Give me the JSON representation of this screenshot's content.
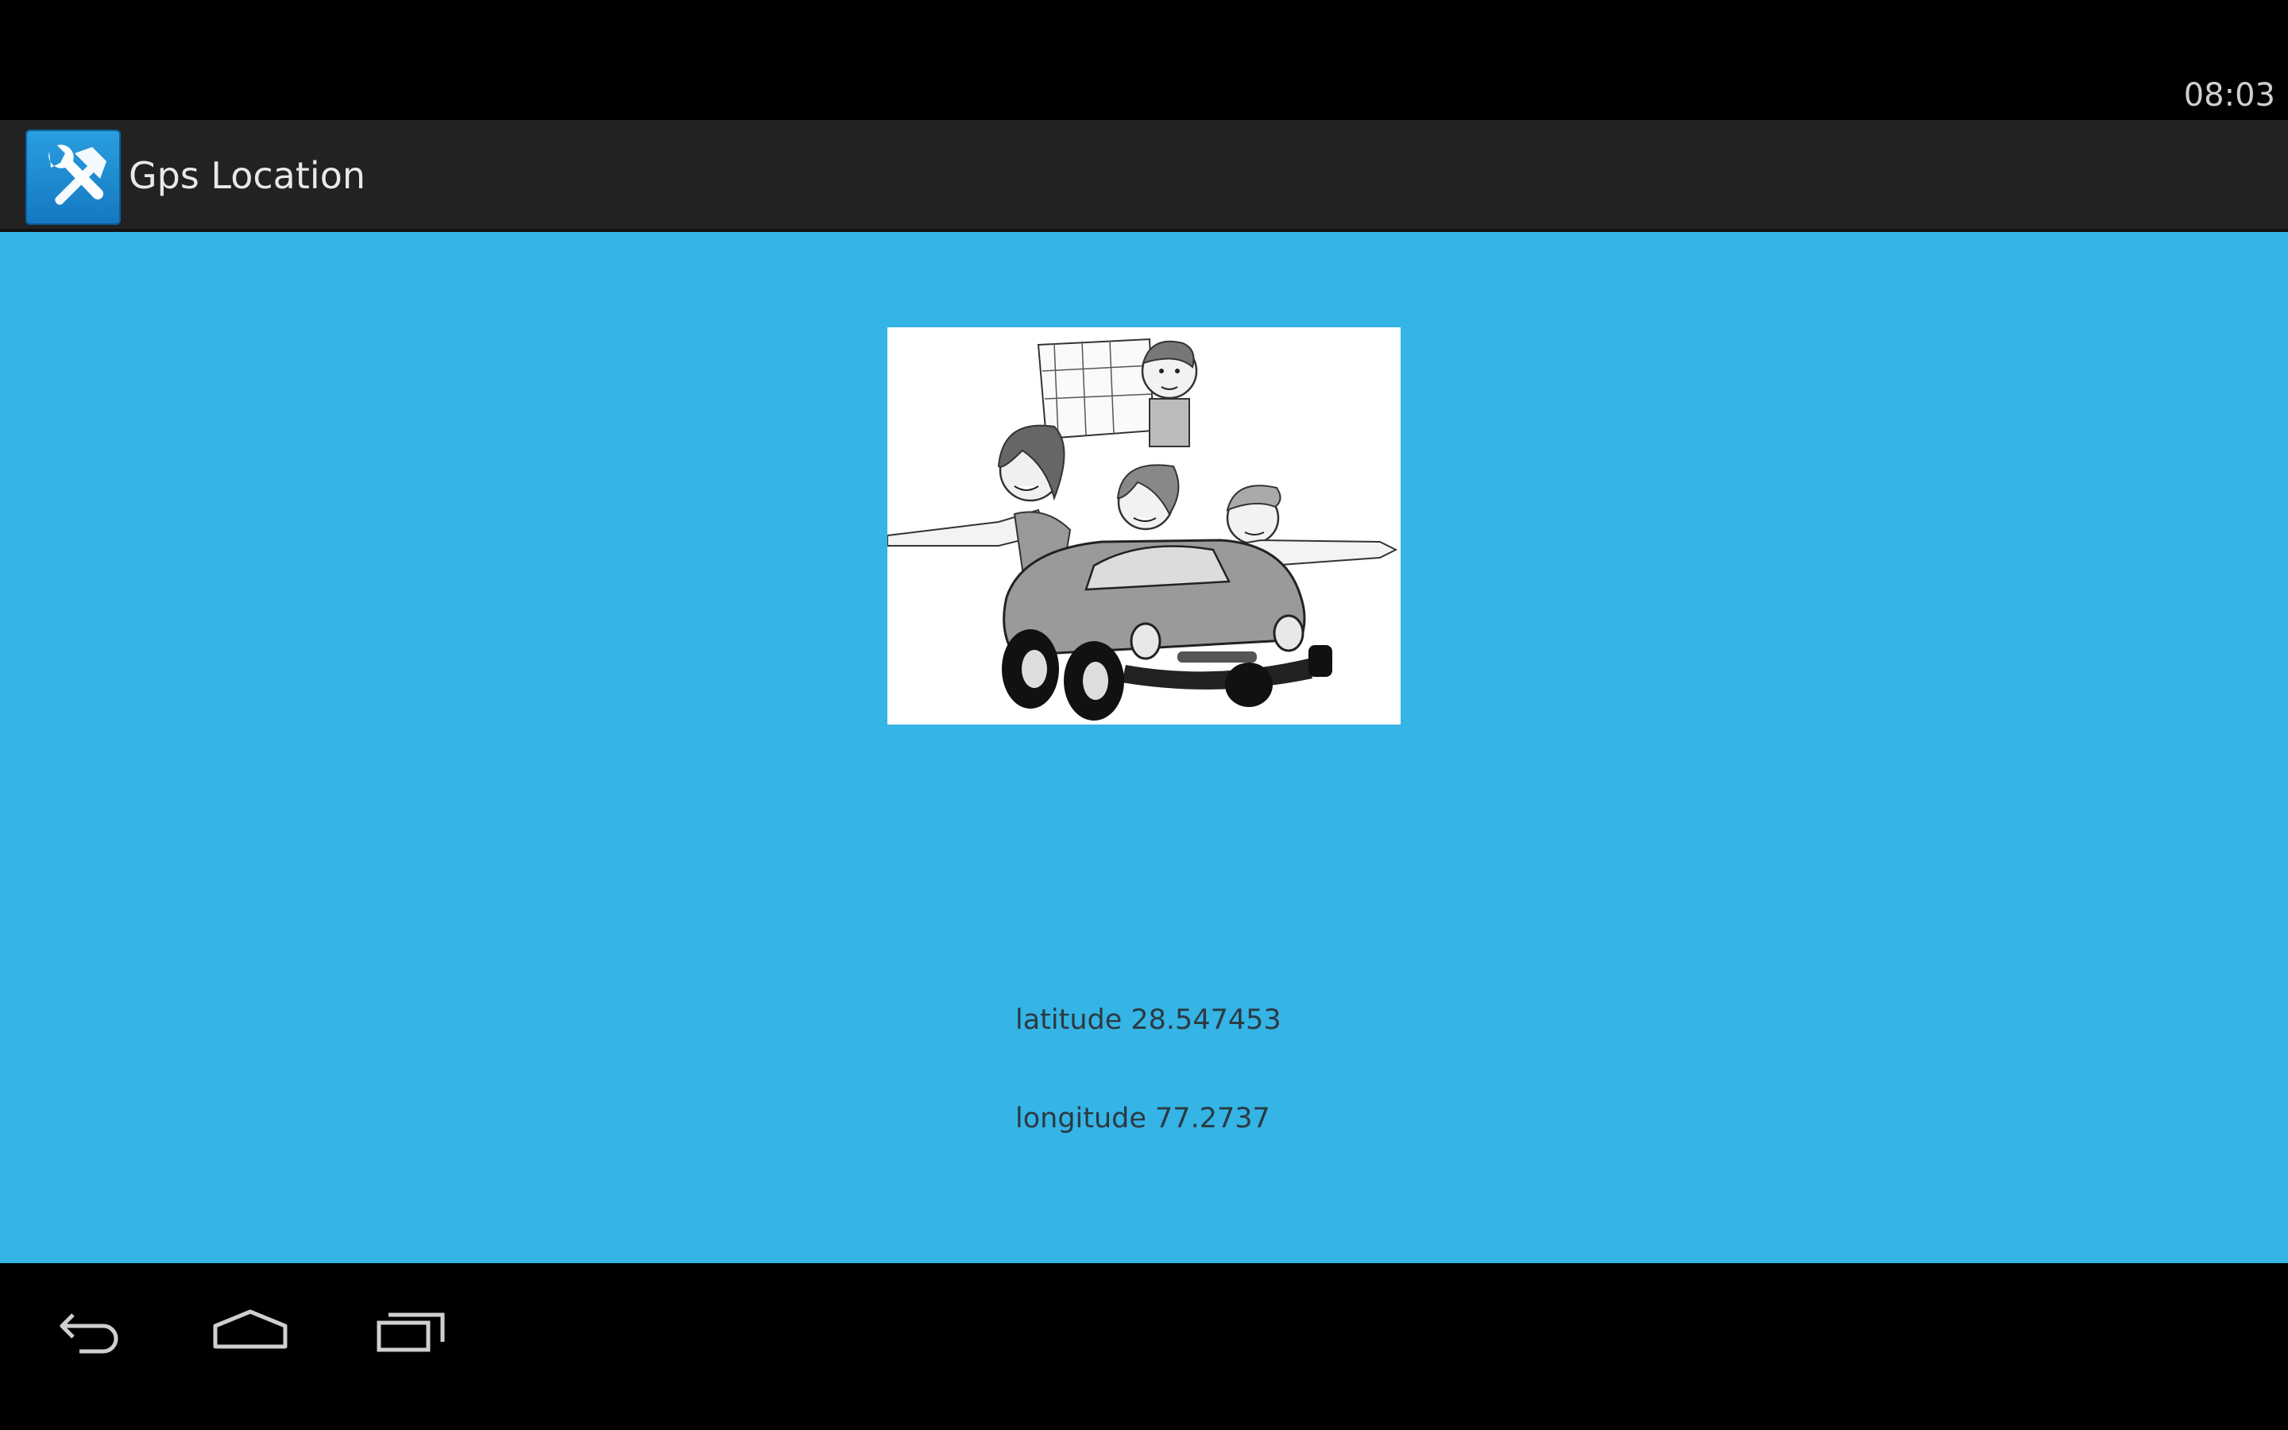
{
  "status_bar": {
    "time": "08:03"
  },
  "action_bar": {
    "app_icon": "tools-icon",
    "title": "Gps Location"
  },
  "main": {
    "illustration": "family-road-trip-car-cartoon",
    "latitude_text": "latitude 28.547453",
    "longitude_text": "longitude 77.2737",
    "background_color": "#35b4e6"
  },
  "nav_bar": {
    "back": "back-icon",
    "home": "home-icon",
    "recent": "recent-apps-icon"
  }
}
